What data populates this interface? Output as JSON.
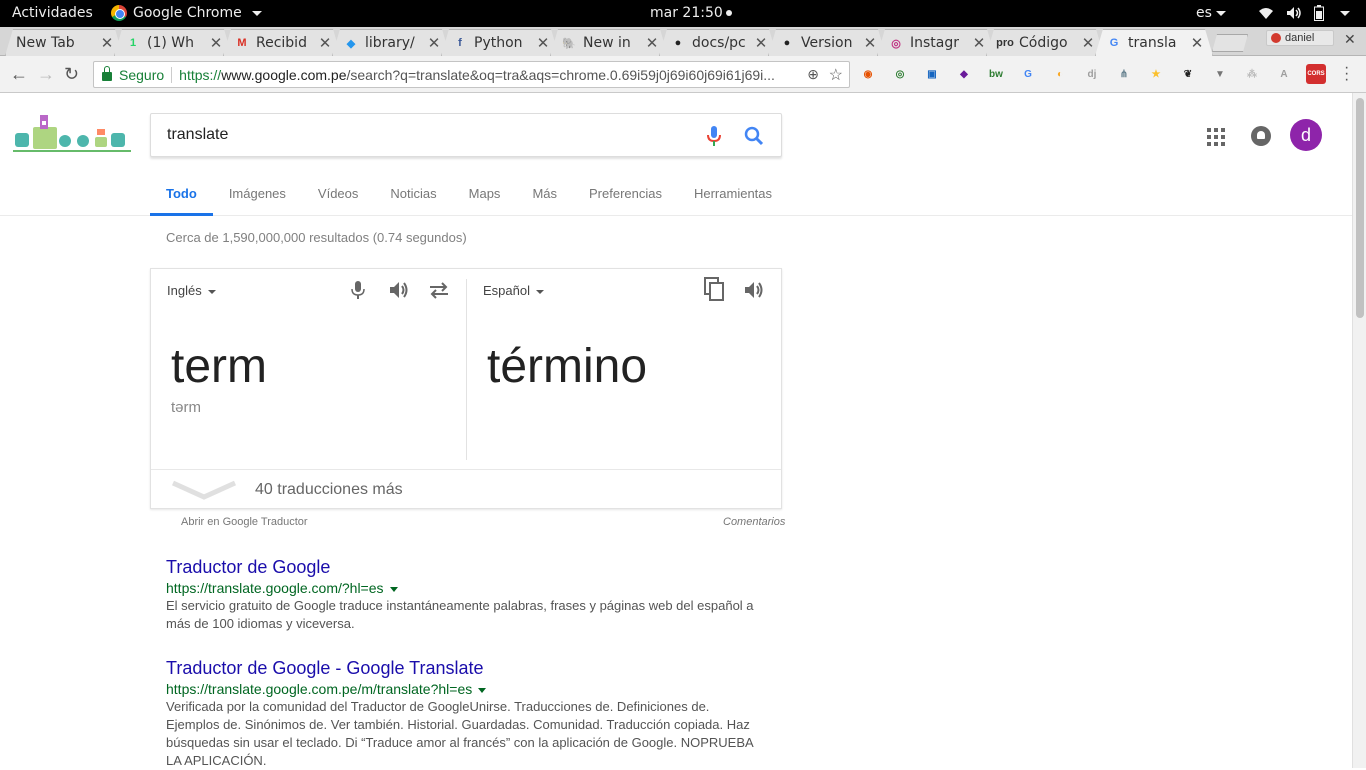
{
  "topbar": {
    "activities": "Actividades",
    "app_name": "Google Chrome",
    "clock": "mar 21:50",
    "language": "es"
  },
  "tabs": [
    {
      "label": "New Tab",
      "icon": "none",
      "color": "#e3e3e3"
    },
    {
      "label": "(1) Wh",
      "icon": "whatsapp-icon",
      "glyph": "1",
      "color": "#25d366"
    },
    {
      "label": "Recibid",
      "icon": "gmail-icon",
      "glyph": "M",
      "color": "#d93025"
    },
    {
      "label": "library/",
      "icon": "docker-icon",
      "glyph": "◆",
      "color": "#2496ed"
    },
    {
      "label": "Python",
      "icon": "facebook-icon",
      "glyph": "f",
      "color": "#3b5998"
    },
    {
      "label": "New in",
      "icon": "postgres-icon",
      "glyph": "🐘",
      "color": "#336791"
    },
    {
      "label": "docs/pc",
      "icon": "github-icon",
      "glyph": "●",
      "color": "#222"
    },
    {
      "label": "Version",
      "icon": "github-icon",
      "glyph": "●",
      "color": "#222"
    },
    {
      "label": "Instagr",
      "icon": "instagram-icon",
      "glyph": "◎",
      "color": "#c13584"
    },
    {
      "label": "Código",
      "icon": "pro-icon",
      "glyph": "pro",
      "color": "#333"
    },
    {
      "label": "transla",
      "icon": "google-icon",
      "glyph": "G",
      "color": "#4285f4"
    }
  ],
  "profile": "daniel",
  "omnibox": {
    "secure_label": "Seguro",
    "url_scheme": "https://",
    "url_host": "www.google.com.pe",
    "url_rest": "/search?q=translate&oq=tra&aqs=chrome.0.69i59j0j69i60j69i61j69i..."
  },
  "extensions": [
    {
      "name": "ext-1-icon",
      "glyph": "◉",
      "color": "#e65100"
    },
    {
      "name": "ext-2-icon",
      "glyph": "◎",
      "color": "#2e7d32"
    },
    {
      "name": "ext-3-icon",
      "glyph": "▣",
      "color": "#1565c0"
    },
    {
      "name": "ext-4-icon",
      "glyph": "◆",
      "color": "#6a1b9a"
    },
    {
      "name": "ext-bw-icon",
      "glyph": "bw",
      "color": "#2e7d32"
    },
    {
      "name": "ext-google-icon",
      "glyph": "G",
      "color": "#4285f4"
    },
    {
      "name": "ext-6-icon",
      "glyph": "◐",
      "color": "#f9a825"
    },
    {
      "name": "ext-dj-icon",
      "glyph": "dj",
      "color": "#9e9e9e"
    },
    {
      "name": "ext-8-icon",
      "glyph": "⋔",
      "color": "#607d8b"
    },
    {
      "name": "ext-9-icon",
      "glyph": "★",
      "color": "#fbc02d"
    },
    {
      "name": "ext-10-icon",
      "glyph": "❦",
      "color": "#222"
    },
    {
      "name": "ext-11-icon",
      "glyph": "▼",
      "color": "#757575"
    },
    {
      "name": "ext-12-icon",
      "glyph": "⁂",
      "color": "#bdbdbd"
    },
    {
      "name": "ext-13-icon",
      "glyph": "A",
      "color": "#9e9e9e"
    },
    {
      "name": "ext-cors-icon",
      "glyph": "CORS",
      "color": "#d32f2f"
    }
  ],
  "search": {
    "query": "translate"
  },
  "nav_tabs": [
    "Todo",
    "Imágenes",
    "Vídeos",
    "Noticias",
    "Maps",
    "Más",
    "Preferencias",
    "Herramientas"
  ],
  "result_stats": "Cerca de 1,590,000,000 resultados (0.74 segundos)",
  "translate": {
    "source_lang": "Inglés",
    "target_lang": "Español",
    "source_word": "term",
    "phonetic": "tərm",
    "target_word": "término",
    "more": "40 traducciones más",
    "open_link": "Abrir en Google Traductor",
    "feedback": "Comentarios"
  },
  "results": [
    {
      "title": "Traductor de Google",
      "url": "https://translate.google.com/?hl=es",
      "snippet": "El servicio gratuito de Google traduce instantáneamente palabras, frases y páginas web del español a más de 100 idiomas y viceversa."
    },
    {
      "title": "Traductor de Google - Google Translate",
      "url": "https://translate.google.com.pe/m/translate?hl=es",
      "snippet": "Verificada por la comunidad del Traductor de GoogleUnirse. Traducciones de. Definiciones de. Ejemplos de. Sinónimos de. Ver también. Historial. Guardadas. Comunidad. Traducción copiada. Haz búsquedas sin usar el teclado. Di “Traduce amor al francés” con la aplicación de Google. NOPRUEBA LA APLICACIÓN."
    }
  ],
  "avatar_letter": "d",
  "colors": {
    "link": "#1a0dab",
    "url_green": "#006621",
    "accent_blue": "#1a73e8",
    "avatar": "#8e24aa"
  }
}
